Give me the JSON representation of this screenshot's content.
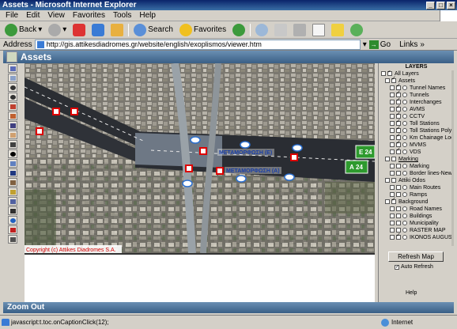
{
  "window": {
    "title": "Assets - Microsoft Internet Explorer"
  },
  "menu": [
    "File",
    "Edit",
    "View",
    "Favorites",
    "Tools",
    "Help"
  ],
  "toolbar": {
    "back_label": "Back",
    "search_label": "Search",
    "favorites_label": "Favorites"
  },
  "address": {
    "label": "Address",
    "url": "http://gis.attikesdiadromes.gr/website/english/exoplismos/viewer.htm",
    "go_label": "Go",
    "links_label": "Links"
  },
  "app": {
    "title": "Assets"
  },
  "map": {
    "copyright": "Copyright (c) Attikes Diadromes S.A.",
    "label_upper": "ΜΕΤΑΜΟΡΦΩΣΗ (Ε)",
    "label_lower": "ΜΕΤΑΜΟΡΦΩΣΗ (Α)",
    "sign_e": "Ε 24",
    "sign_a": "Α 24"
  },
  "layers_panel": {
    "title": "LAYERS",
    "items": [
      {
        "label": "All Layers",
        "indent": 0,
        "checked": true
      },
      {
        "label": "Assets",
        "indent": 1,
        "checked": true
      },
      {
        "label": "Tunnel Names",
        "indent": 2,
        "checked": true
      },
      {
        "label": "Tunnels",
        "indent": 2,
        "checked": true
      },
      {
        "label": "Interchanges",
        "indent": 2,
        "checked": true
      },
      {
        "label": "AVMS",
        "indent": 2,
        "checked": true
      },
      {
        "label": "CCTV",
        "indent": 2,
        "checked": true
      },
      {
        "label": "Toll Stations",
        "indent": 2,
        "checked": true
      },
      {
        "label": "Toll Stations Polyg",
        "indent": 2,
        "checked": true
      },
      {
        "label": "Km Chainage Loca",
        "indent": 2,
        "checked": true
      },
      {
        "label": "MVMS",
        "indent": 2,
        "checked": true
      },
      {
        "label": "VDS",
        "indent": 2,
        "checked": true
      },
      {
        "label": "Marking",
        "indent": 1,
        "checked": false
      },
      {
        "label": "Marking",
        "indent": 2,
        "checked": false
      },
      {
        "label": "Border lines-New 2",
        "indent": 2,
        "checked": false
      },
      {
        "label": "Attiki Odos",
        "indent": 1,
        "checked": false
      },
      {
        "label": "Main Routes",
        "indent": 2,
        "checked": false
      },
      {
        "label": "Ramps",
        "indent": 2,
        "checked": false
      },
      {
        "label": "Background",
        "indent": 1,
        "checked": true
      },
      {
        "label": "Road Names",
        "indent": 2,
        "checked": false
      },
      {
        "label": "Buildings",
        "indent": 2,
        "checked": false
      },
      {
        "label": "Municipality",
        "indent": 2,
        "checked": false
      },
      {
        "label": "RASTER MAP",
        "indent": 2,
        "checked": false
      },
      {
        "label": "IKONOS AUGUST",
        "indent": 2,
        "checked": true
      }
    ],
    "refresh_label": "Refresh Map",
    "auto_refresh_label": "Auto Refresh",
    "help_label": "Help"
  },
  "bottom": {
    "zoom_label": "Zoom Out"
  },
  "status": {
    "text": "javascript:t.toc.onCaptionClick(12);",
    "zone": "Internet"
  }
}
